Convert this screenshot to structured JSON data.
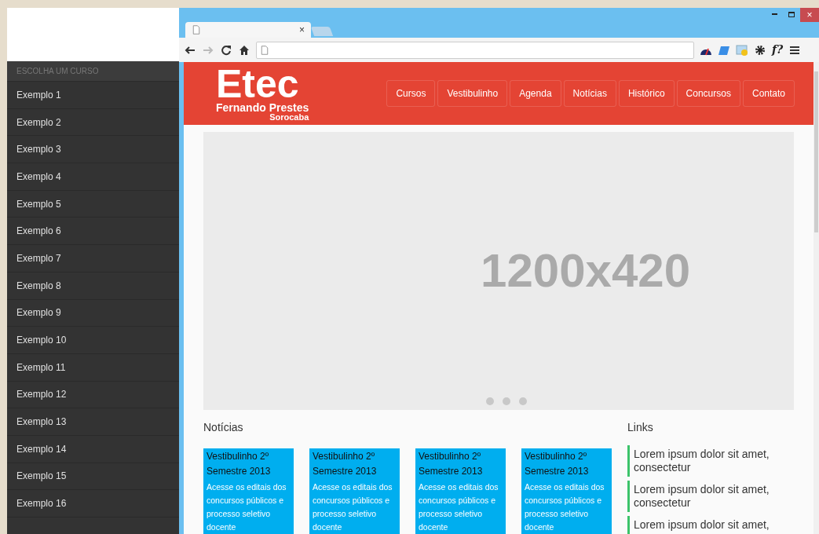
{
  "sidebar": {
    "heading": "ESCOLHA UM CURSO",
    "items": [
      "Exemplo 1",
      "Exemplo 2",
      "Exemplo 3",
      "Exemplo 4",
      "Exemplo 5",
      "Exemplo 6",
      "Exemplo 7",
      "Exemplo 8",
      "Exemplo 9",
      "Exemplo 10",
      "Exemplo 11",
      "Exemplo 12",
      "Exemplo 13",
      "Exemplo 14",
      "Exemplo 15",
      "Exemplo 16"
    ]
  },
  "browser": {
    "tab_close": "×",
    "extension_text": "f?",
    "window_close": "×"
  },
  "site": {
    "logo": {
      "name": "Etec",
      "subtitle": "Fernando Prestes",
      "city": "Sorocaba"
    },
    "nav": [
      "Cursos",
      "Vestibulinho",
      "Agenda",
      "Notícias",
      "Histórico",
      "Concursos",
      "Contato"
    ],
    "slider": {
      "placeholder": "1200x420",
      "dots": [
        {
          "selected": false
        },
        {
          "selected": false
        },
        {
          "selected": false
        }
      ]
    },
    "news": {
      "heading": "Notícias",
      "cards": [
        {
          "title": "Vestibulinho 2º Semestre 2013",
          "body": "Acesse os editais dos concursos públicos e processo seletivo docente"
        },
        {
          "title": "Vestibulinho 2º Semestre 2013",
          "body": "Acesse os editais dos concursos públicos e processo seletivo docente"
        },
        {
          "title": "Vestibulinho 2º Semestre 2013",
          "body": "Acesse os editais dos concursos públicos e processo seletivo docente"
        },
        {
          "title": "Vestibulinho 2º Semestre 2013",
          "body": "Acesse os editais dos concursos públicos e processo seletivo docente"
        }
      ]
    },
    "links": {
      "heading": "Links",
      "items": [
        "Lorem ipsum dolor sit amet, consectetur",
        "Lorem ipsum dolor sit amet, consectetur",
        "Lorem ipsum dolor sit amet,"
      ]
    }
  }
}
